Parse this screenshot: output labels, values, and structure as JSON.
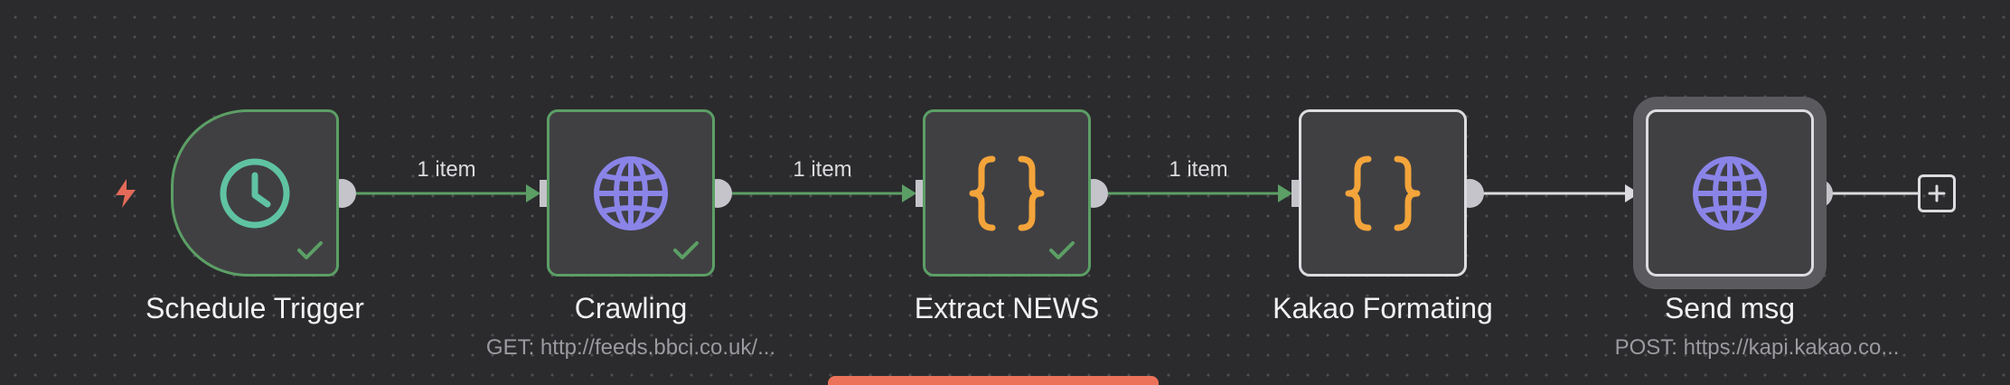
{
  "canvas": {
    "background_color": "#2b2b2d",
    "dot_color": "#4e4e52"
  },
  "colors": {
    "success_border": "#5c9f65",
    "default_border": "#dcdce0",
    "success_edge": "#5c9f65",
    "default_edge": "#dcdce0",
    "clock_icon": "#5fc3a1",
    "globe_icon": "#8a84e8",
    "braces_icon": "#f3a43a",
    "trigger_bolt": "#e36a59",
    "banner": "#ec7259"
  },
  "nodes": [
    {
      "id": "schedule-trigger",
      "label": "Schedule Trigger",
      "subtitle": "",
      "icon": "clock-icon",
      "status": "success"
    },
    {
      "id": "crawling",
      "label": "Crawling",
      "subtitle": "GET: http://feeds.bbci.co.uk/...",
      "icon": "globe-icon",
      "status": "success"
    },
    {
      "id": "extract-news",
      "label": "Extract NEWS",
      "subtitle": "",
      "icon": "code-braces-icon",
      "status": "success"
    },
    {
      "id": "kakao-formating",
      "label": "Kakao Formating",
      "subtitle": "",
      "icon": "code-braces-icon",
      "status": "idle"
    },
    {
      "id": "send-msg",
      "label": "Send msg",
      "subtitle": "POST: https://kapi.kakao.co...",
      "icon": "globe-icon",
      "status": "idle",
      "selected": true
    }
  ],
  "connections": [
    {
      "from": "schedule-trigger",
      "to": "crawling",
      "label": "1 item",
      "status": "success"
    },
    {
      "from": "crawling",
      "to": "extract-news",
      "label": "1 item",
      "status": "success"
    },
    {
      "from": "extract-news",
      "to": "kakao-formating",
      "label": "1 item",
      "status": "success"
    },
    {
      "from": "kakao-formating",
      "to": "send-msg",
      "label": "",
      "status": "idle"
    }
  ],
  "trigger_icon": "lightning-bolt-icon",
  "add_node_icon": "plus-icon"
}
